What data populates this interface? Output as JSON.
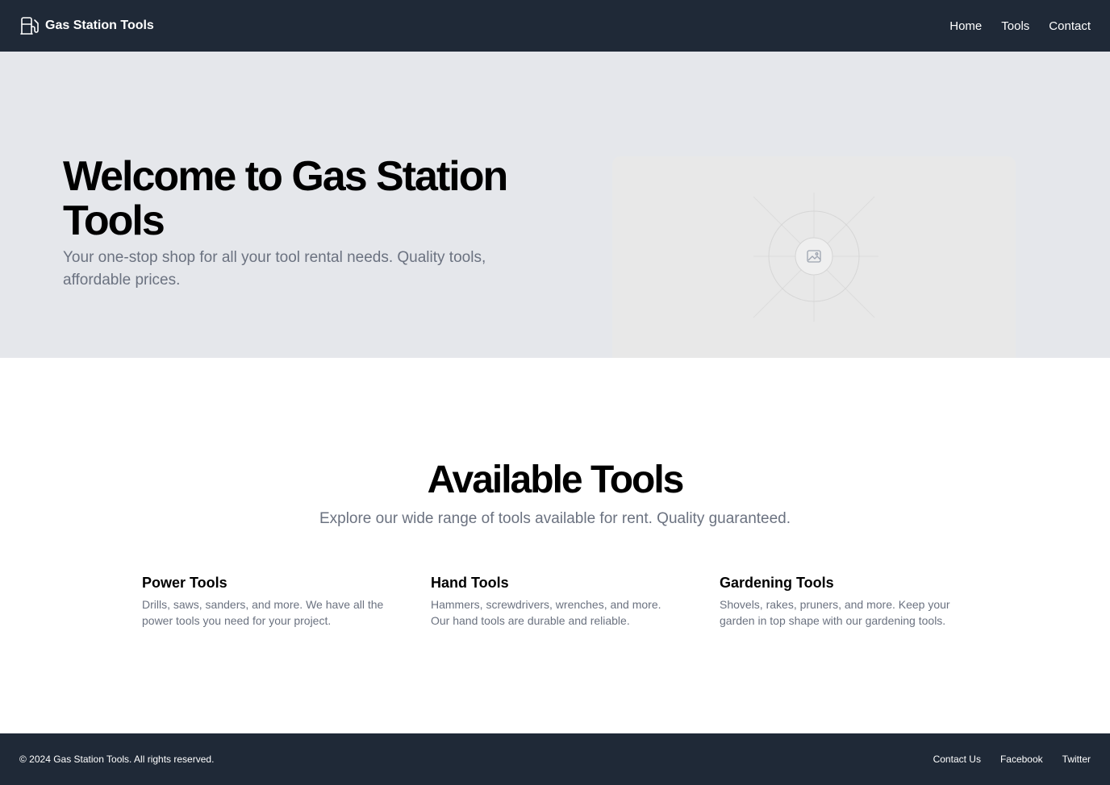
{
  "header": {
    "brand": "Gas Station Tools",
    "brand_icon": "fuel-pump-icon",
    "nav": [
      "Home",
      "Tools",
      "Contact"
    ]
  },
  "hero": {
    "title": "Welcome to Gas Station Tools",
    "subtitle": "Your one-stop shop for all your tool rental needs. Quality tools, affordable prices.",
    "image_icon": "image-placeholder-icon"
  },
  "tools_section": {
    "title": "Available Tools",
    "subtitle": "Explore our wide range of tools available for rent. Quality guaranteed.",
    "items": [
      {
        "name": "Power Tools",
        "description": "Drills, saws, sanders, and more. We have all the power tools you need for your project."
      },
      {
        "name": "Hand Tools",
        "description": "Hammers, screwdrivers, wrenches, and more. Our hand tools are durable and reliable."
      },
      {
        "name": "Gardening Tools",
        "description": "Shovels, rakes, pruners, and more. Keep your garden in top shape with our gardening tools."
      }
    ]
  },
  "footer": {
    "copyright": "© 2024 Gas Station Tools. All rights reserved.",
    "links": [
      "Contact Us",
      "Facebook",
      "Twitter"
    ]
  },
  "colors": {
    "header_bg": "#1f2937",
    "hero_bg": "#e5e7eb",
    "muted_text": "#6b7280"
  }
}
